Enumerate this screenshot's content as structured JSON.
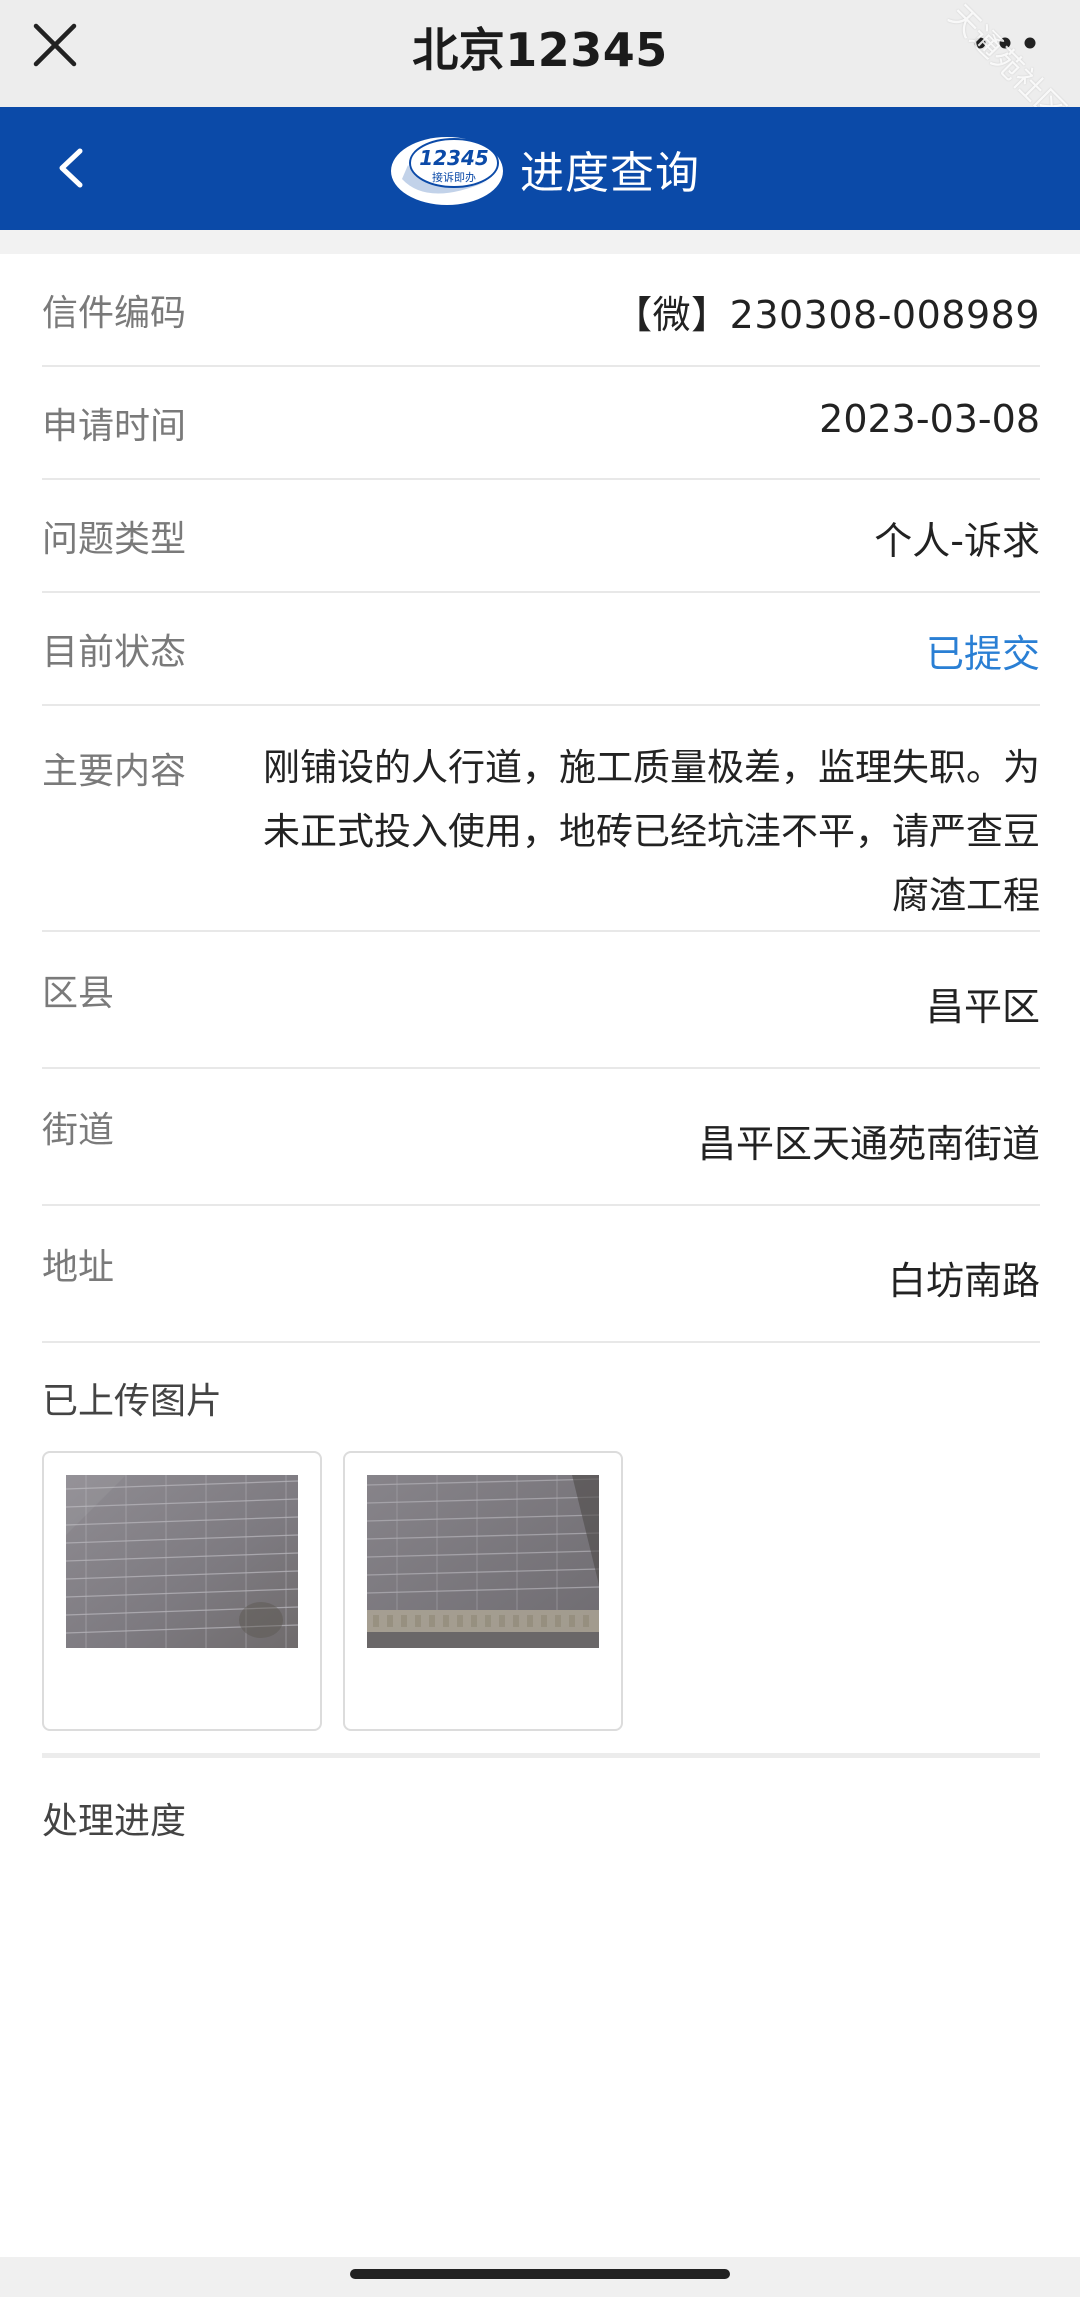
{
  "window": {
    "title": "北京12345",
    "watermark": "天通苑社区网"
  },
  "header": {
    "title": "进度查询",
    "logo_number": "12345",
    "logo_text": "接诉即办"
  },
  "fields": {
    "code": {
      "label": "信件编码",
      "value": "【微】230308-008989"
    },
    "date": {
      "label": "申请时间",
      "value": "2023-03-08"
    },
    "type": {
      "label": "问题类型",
      "value": "个人-诉求"
    },
    "status": {
      "label": "目前状态",
      "value": "已提交"
    },
    "content": {
      "label": "主要内容",
      "value": "刚铺设的人行道，施工质量极差，监理失职。为未正式投入使用，地砖已经坑洼不平，请严查豆腐渣工程"
    },
    "district": {
      "label": "区县",
      "value": "昌平区"
    },
    "street": {
      "label": "街道",
      "value": "昌平区天通苑南街道"
    },
    "address": {
      "label": "地址",
      "value": "白坊南路"
    }
  },
  "photos": {
    "title": "已上传图片"
  },
  "progress": {
    "title": "处理进度"
  },
  "colors": {
    "appbar": "#0b4aa8",
    "status": "#2a7fd4"
  }
}
